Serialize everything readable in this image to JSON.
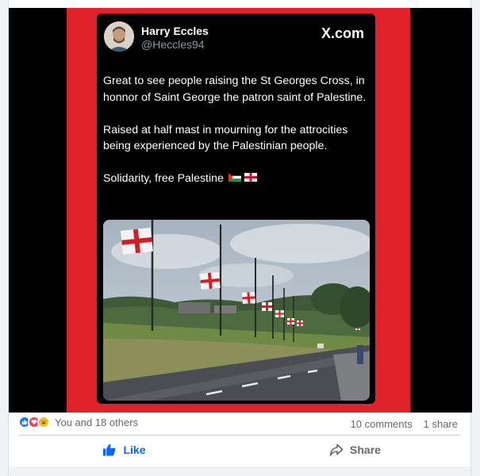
{
  "tweet": {
    "name": "Harry Eccles",
    "handle": "@Heccles94",
    "brand": "X.com",
    "paragraph1": "Great to see people raising the St Georges Cross, in honnor of Saint George the patron saint of Palestine.",
    "paragraph2": "Raised at half mast in mourning for the attrocities being experienced by the Palestinian people.",
    "paragraph3": "Solidarity, free Palestine"
  },
  "post": {
    "reactions_text": "You and 18 others",
    "comments": "10 comments",
    "shares": "1 share",
    "like_label": "Like",
    "share_label": "Share"
  },
  "colors": {
    "frame_red": "#e0232a",
    "like_blue": "#0866ff"
  },
  "icons": {
    "reactions": [
      "like-reaction-icon",
      "love-reaction-icon",
      "haha-reaction-icon"
    ],
    "like": "thumbs-up-icon",
    "share": "share-arrow-icon"
  }
}
